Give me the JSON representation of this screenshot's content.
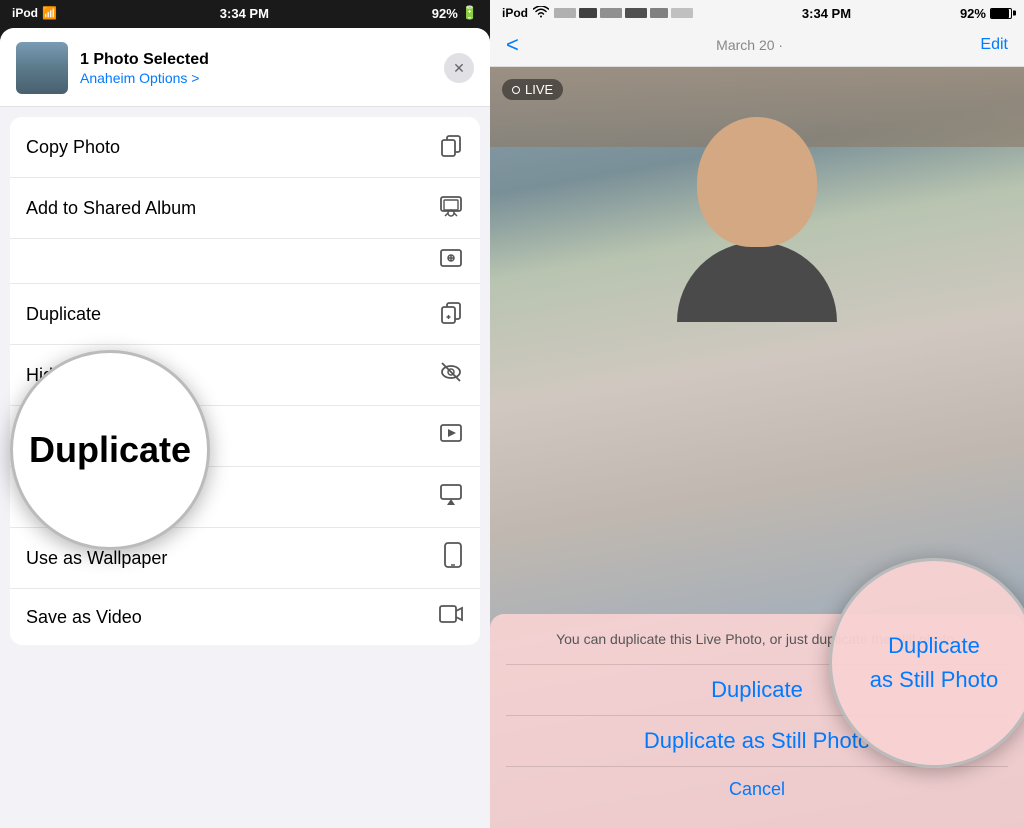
{
  "left": {
    "status": {
      "carrier": "iPod",
      "time": "3:34 PM",
      "battery": "92%"
    },
    "header": {
      "title": "1 Photo Selected",
      "location": "Anaheim",
      "options_label": "Options >"
    },
    "menu_items": [
      {
        "id": "copy-photo",
        "label": "Copy Photo",
        "icon": "copy"
      },
      {
        "id": "add-shared-album",
        "label": "Add to Shared Album",
        "icon": "shared-album"
      },
      {
        "id": "add-album",
        "label": "Add to Album",
        "icon": "add-album"
      },
      {
        "id": "duplicate",
        "label": "Duplicate",
        "icon": "duplicate"
      },
      {
        "id": "hide",
        "label": "Hide",
        "icon": "hide"
      },
      {
        "id": "slideshow",
        "label": "Slideshow",
        "icon": "slideshow"
      },
      {
        "id": "airplay",
        "label": "AirPlay",
        "icon": "airplay"
      },
      {
        "id": "wallpaper",
        "label": "Use as Wallpaper",
        "icon": "phone"
      },
      {
        "id": "save-video",
        "label": "Save as Video",
        "icon": "video"
      }
    ],
    "magnifier": {
      "text": "Duplicate"
    }
  },
  "right": {
    "status": {
      "carrier": "iPod",
      "time": "3:34 PM",
      "battery": "92%"
    },
    "nav": {
      "back": "<",
      "date": "March 20 ·",
      "edit": "Edit"
    },
    "live_badge": "LIVE",
    "action_sheet": {
      "description": "You can duplicate this Live Photo, or just duplicate the still photo.",
      "btn_duplicate": "Duplicate",
      "btn_duplicate_still": "Duplicate as Still Photo",
      "btn_cancel": "Cancel"
    },
    "magnifier": {
      "text1": "Duplicate",
      "text2": "as Still Photo"
    }
  }
}
